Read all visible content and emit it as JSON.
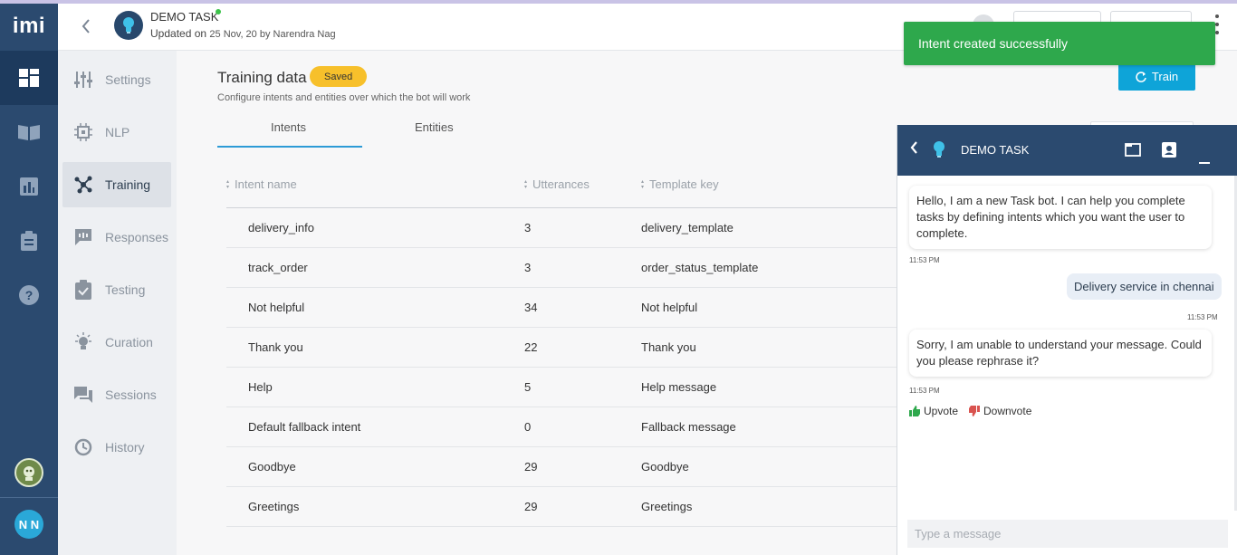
{
  "app": {
    "logo": "imi"
  },
  "rail": {
    "items": [
      {
        "icon": "dashboard-icon"
      },
      {
        "icon": "book-icon"
      },
      {
        "icon": "bar-chart-icon"
      },
      {
        "icon": "clipboard-icon"
      },
      {
        "icon": "help-icon"
      }
    ],
    "user_initials": "N N"
  },
  "header": {
    "bot_name": "DEMO TASK",
    "updated_prefix": "Updated on",
    "updated_detail": "25 Nov, 20 by Narendra Nag"
  },
  "sidebar": {
    "items": [
      {
        "label": "Settings",
        "icon": "sliders-icon"
      },
      {
        "label": "NLP",
        "icon": "chip-icon"
      },
      {
        "label": "Training",
        "icon": "network-icon",
        "active": true
      },
      {
        "label": "Responses",
        "icon": "message-icon"
      },
      {
        "label": "Testing",
        "icon": "clipboard-check-icon"
      },
      {
        "label": "Curation",
        "icon": "bulb-icon"
      },
      {
        "label": "Sessions",
        "icon": "chat-icon"
      },
      {
        "label": "History",
        "icon": "history-icon"
      }
    ]
  },
  "main": {
    "title": "Training data",
    "badge": "Saved",
    "description": "Configure intents and entities over which the bot will work",
    "train_label": "Train",
    "tabs": [
      {
        "label": "Intents",
        "active": true
      },
      {
        "label": "Entities"
      }
    ],
    "table": {
      "columns": [
        "Intent name",
        "Utterances",
        "Template key"
      ],
      "rows": [
        [
          "delivery_info",
          "3",
          "delivery_template"
        ],
        [
          "track_order",
          "3",
          "order_status_template"
        ],
        [
          "Not helpful",
          "34",
          "Not helpful"
        ],
        [
          "Thank you",
          "22",
          "Thank you"
        ],
        [
          "Help",
          "5",
          "Help message"
        ],
        [
          "Default fallback intent",
          "0",
          "Fallback message"
        ],
        [
          "Goodbye",
          "29",
          "Goodbye"
        ],
        [
          "Greetings",
          "29",
          "Greetings"
        ]
      ]
    }
  },
  "toast": {
    "message": "Intent created successfully"
  },
  "chat": {
    "title": "DEMO TASK",
    "messages": [
      {
        "from": "bot",
        "text": "Hello, I am a new Task bot. I can help you complete tasks by defining intents which you want the user to complete.",
        "time": "11:53 PM"
      },
      {
        "from": "user",
        "text": "Delivery service in chennai",
        "time": "11:53 PM"
      },
      {
        "from": "bot",
        "text": "Sorry, I am unable to understand your message. Could you please rephrase it?",
        "time": "11:53 PM"
      }
    ],
    "upvote": "Upvote",
    "downvote": "Downvote",
    "input_placeholder": "Type a message"
  },
  "colors": {
    "rail": "#2b4a6f",
    "accent": "#0ea4d8",
    "toast": "#2ea84c",
    "badge": "#f7c02b"
  }
}
